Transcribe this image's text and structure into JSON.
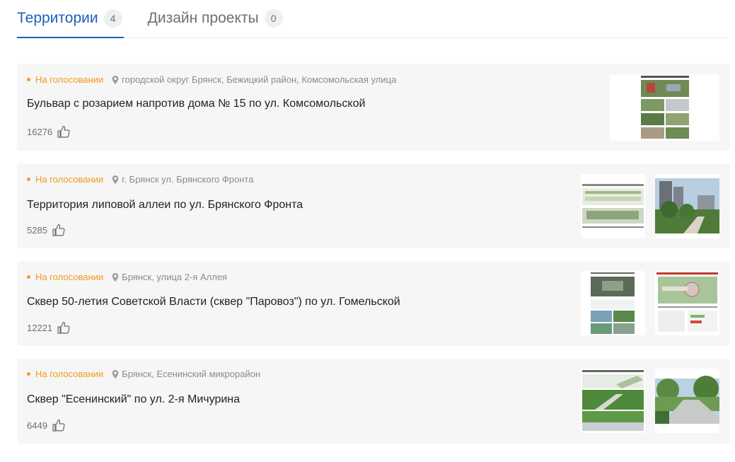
{
  "tabs": [
    {
      "label": "Территории",
      "count": "4"
    },
    {
      "label": "Дизайн проекты",
      "count": "0"
    }
  ],
  "projects": [
    {
      "status": "На голосовании",
      "address": "городской округ Брянск, Бежицкий район, Комсомольская улица",
      "title": "Бульвар с розарием напротив дома № 15 по ул. Комсомольской",
      "likes": "16276"
    },
    {
      "status": "На голосовании",
      "address": "г. Брянск ул. Брянского Фронта",
      "title": "Территория липовой аллеи по ул. Брянского Фронта",
      "likes": "5285"
    },
    {
      "status": "На голосовании",
      "address": "Брянск, улица 2-я Аллея",
      "title": "Сквер 50-летия Советской Власти (сквер \"Паровоз\") по ул. Гомельской",
      "likes": "12221"
    },
    {
      "status": "На голосовании",
      "address": "Брянск, Есенинский микрорайон",
      "title": "Сквер \"Есенинский\" по ул. 2-я Мичурина",
      "likes": "6449"
    }
  ],
  "icons": {
    "location": "map-pin-icon",
    "like": "thumbs-up-icon"
  },
  "colors": {
    "accent": "#1e5fb8",
    "status": "#f29a1c",
    "card_bg": "#f6f6f6"
  }
}
